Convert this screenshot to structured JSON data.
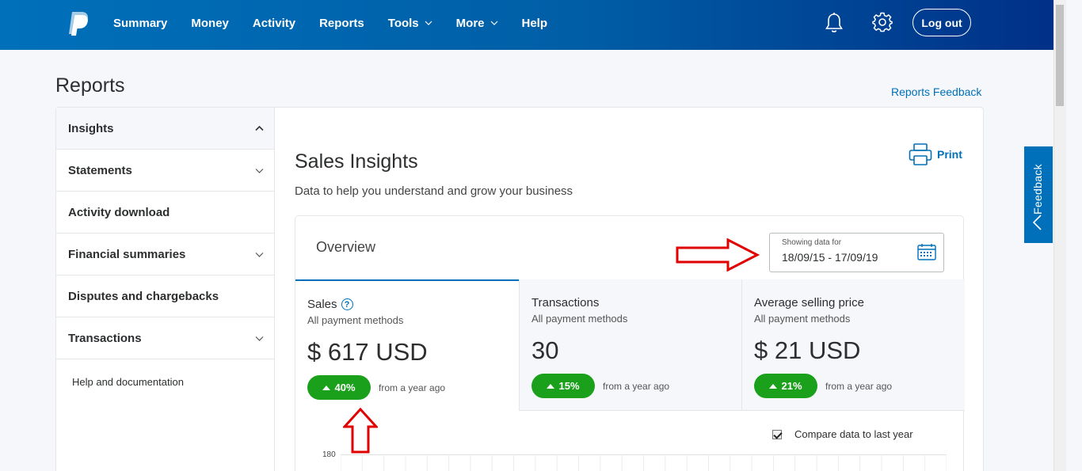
{
  "nav": {
    "items": [
      {
        "label": "Summary",
        "dropdown": false
      },
      {
        "label": "Money",
        "dropdown": false
      },
      {
        "label": "Activity",
        "dropdown": false
      },
      {
        "label": "Reports",
        "dropdown": false
      },
      {
        "label": "Tools",
        "dropdown": true
      },
      {
        "label": "More",
        "dropdown": true
      },
      {
        "label": "Help",
        "dropdown": false
      }
    ],
    "logout_label": "Log out"
  },
  "page": {
    "title": "Reports",
    "feedback_link": "Reports Feedback",
    "feedback_tab": "Feedback"
  },
  "sidebar": {
    "items": [
      {
        "label": "Insights",
        "expandable": true,
        "expanded": true
      },
      {
        "label": "Statements",
        "expandable": true,
        "expanded": false
      },
      {
        "label": "Activity download",
        "expandable": false
      },
      {
        "label": "Financial summaries",
        "expandable": true,
        "expanded": false
      },
      {
        "label": "Disputes and chargebacks",
        "expandable": false
      },
      {
        "label": "Transactions",
        "expandable": true,
        "expanded": false
      }
    ],
    "help": "Help and documentation"
  },
  "insights": {
    "title": "Sales Insights",
    "subtitle": "Data to help you understand and grow your business",
    "print_label": "Print",
    "overview_label": "Overview",
    "date_label": "Showing data for",
    "date_range": "18/09/15 - 17/09/19",
    "tabs": [
      {
        "name": "Sales",
        "sub": "All payment methods",
        "value": "$ 617 USD",
        "change": "40%",
        "from": "from a year ago",
        "help": "?"
      },
      {
        "name": "Transactions",
        "sub": "All payment methods",
        "value": "30",
        "change": "15%",
        "from": "from a year ago"
      },
      {
        "name": "Average selling price",
        "sub": "All payment methods",
        "value": "$ 21 USD",
        "change": "21%",
        "from": "from a year ago"
      }
    ],
    "compare_label": "Compare data to last year",
    "compare_checked": true,
    "y_tick_top": "180"
  },
  "colors": {
    "brand": "#0070ba",
    "brand_dark": "#003087",
    "success": "#1aa01a",
    "annotation": "#e00000"
  }
}
